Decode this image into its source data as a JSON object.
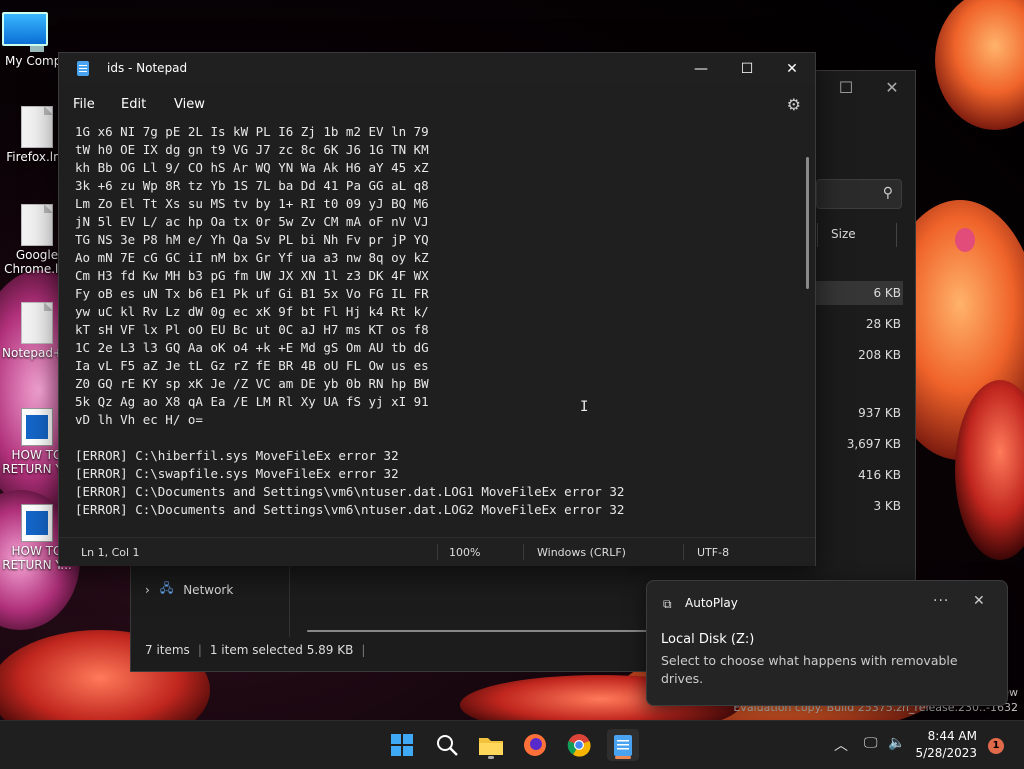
{
  "desktop": {
    "icons": [
      {
        "label": "My Compu"
      },
      {
        "label": "Firefox.lnk"
      },
      {
        "label": "Google Chrome.l..."
      },
      {
        "label": "Notepad+..."
      },
      {
        "label": "HOW TO RETURN Y..."
      },
      {
        "label": "HOW TO RETURN Y..."
      }
    ],
    "watermark": {
      "line1": "ew",
      "line2": "Evaluation copy. Build 25375.zn_release.230..-1632"
    }
  },
  "explorer": {
    "column_size_label": "Size",
    "file_sizes": [
      "6 KB",
      "28 KB",
      "208 KB",
      "937 KB",
      "3,697 KB",
      "416 KB",
      "3 KB"
    ],
    "nav_network": "Network",
    "status": {
      "items": "7 items",
      "selected": "1 item selected  5.89 KB"
    }
  },
  "notepad": {
    "title": "ids - Notepad",
    "menu": {
      "file": "File",
      "edit": "Edit",
      "view": "View"
    },
    "content_lines": [
      "1G x6 NI 7g pE 2L Is kW PL I6 Zj 1b m2 EV ln 79",
      "tW h0 OE IX dg gn t9 VG J7 zc 8c 6K J6 1G TN KM",
      "kh Bb OG Ll 9/ CO hS Ar WQ YN Wa Ak H6 aY 45 xZ",
      "3k +6 zu Wp 8R tz Yb 1S 7L ba Dd 41 Pa GG aL q8",
      "Lm Zo El Tt Xs su MS tv by 1+ RI t0 09 yJ BQ M6",
      "jN 5l EV L/ ac hp Oa tx 0r 5w Zv CM mA oF nV VJ",
      "TG NS 3e P8 hM e/ Yh Qa Sv PL bi Nh Fv pr jP YQ",
      "Ao mN 7E cG GC iI nM bx Gr Yf ua a3 nw 8q oy kZ",
      "Cm H3 fd Kw MH b3 pG fm UW JX XN 1l z3 DK 4F WX",
      "Fy oB es uN Tx b6 E1 Pk uf Gi B1 5x Vo FG IL FR",
      "yw uC kl Rv Lz dW 0g ec xK 9f bt Fl Hj k4 Rt k/",
      "kT sH VF lx Pl oO EU Bc ut 0C aJ H7 ms KT os f8",
      "1C 2e L3 l3 GQ Aa oK o4 +k +E Md gS Om AU tb dG",
      "Ia vL F5 aZ Je tL Gz rZ fE BR 4B oU FL Ow us es",
      "Z0 GQ rE KY sp xK Je /Z VC am DE yb 0b RN hp BW",
      "5k Qz Ag ao X8 qA Ea /E LM Rl Xy UA fS yj xI 91",
      "vD lh Vh ec H/ o=",
      "",
      "[ERROR] C:\\hiberfil.sys MoveFileEx error 32",
      "[ERROR] C:\\swapfile.sys MoveFileEx error 32",
      "[ERROR] C:\\Documents and Settings\\vm6\\ntuser.dat.LOG1 MoveFileEx error 32",
      "[ERROR] C:\\Documents and Settings\\vm6\\ntuser.dat.LOG2 MoveFileEx error 32"
    ],
    "status": {
      "position": "Ln 1, Col 1",
      "zoom": "100%",
      "line_endings": "Windows (CRLF)",
      "encoding": "UTF-8"
    }
  },
  "toast": {
    "app": "AutoPlay",
    "more": "···",
    "heading": "Local Disk (Z:)",
    "body": "Select to choose what happens with removable drives."
  },
  "taskbar": {
    "clock_time": "8:44 AM",
    "clock_date": "5/28/2023",
    "notification_count": "1"
  }
}
